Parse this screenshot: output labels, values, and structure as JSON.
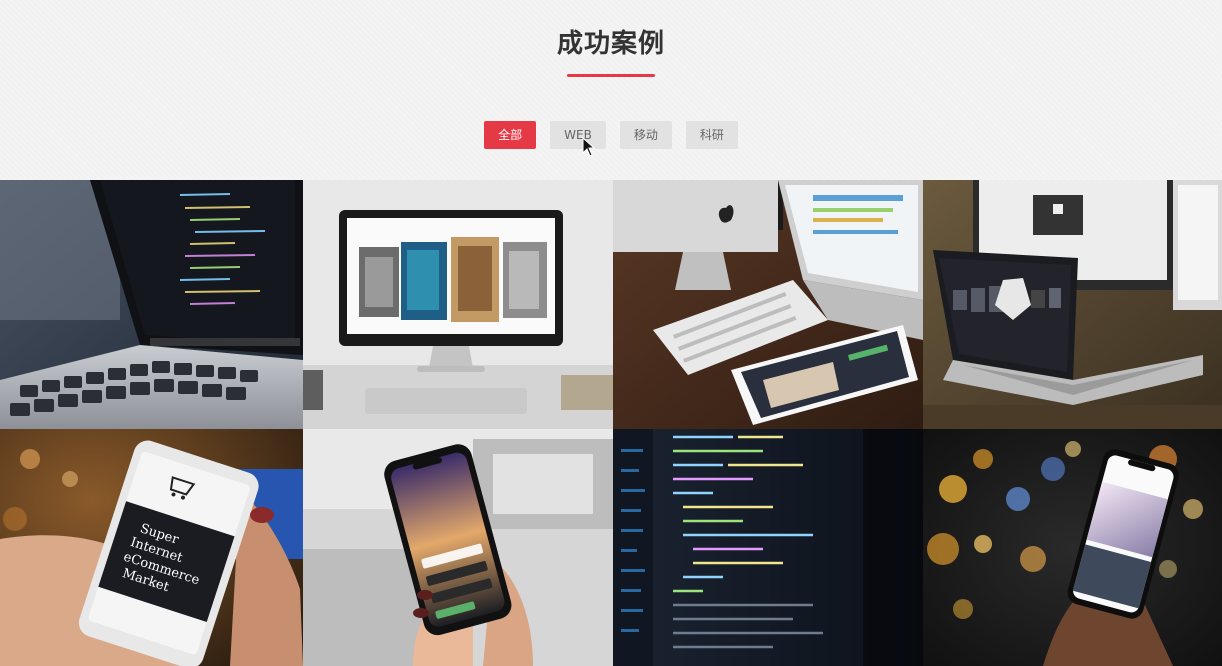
{
  "section": {
    "title": "成功案例"
  },
  "filters": [
    {
      "label": "全部",
      "active": true
    },
    {
      "label": "WEB",
      "active": false
    },
    {
      "label": "移动",
      "active": false
    },
    {
      "label": "科研",
      "active": false
    }
  ],
  "colors": {
    "accent": "#e63946",
    "filter_bg": "#e2e2e2",
    "page_bg": "#f4f4f4"
  },
  "cases": [
    {
      "image": "laptop-code-photo"
    },
    {
      "image": "monitor-gallery-photo"
    },
    {
      "image": "imac-ipad-keyboard-photo"
    },
    {
      "image": "laptop-design-photo"
    },
    {
      "image": "phone-ecommerce-photo",
      "screen_text": "Super Internet eCommerce Market"
    },
    {
      "image": "phone-app-photo"
    },
    {
      "image": "code-editor-photo"
    },
    {
      "image": "phone-bokeh-photo"
    }
  ]
}
